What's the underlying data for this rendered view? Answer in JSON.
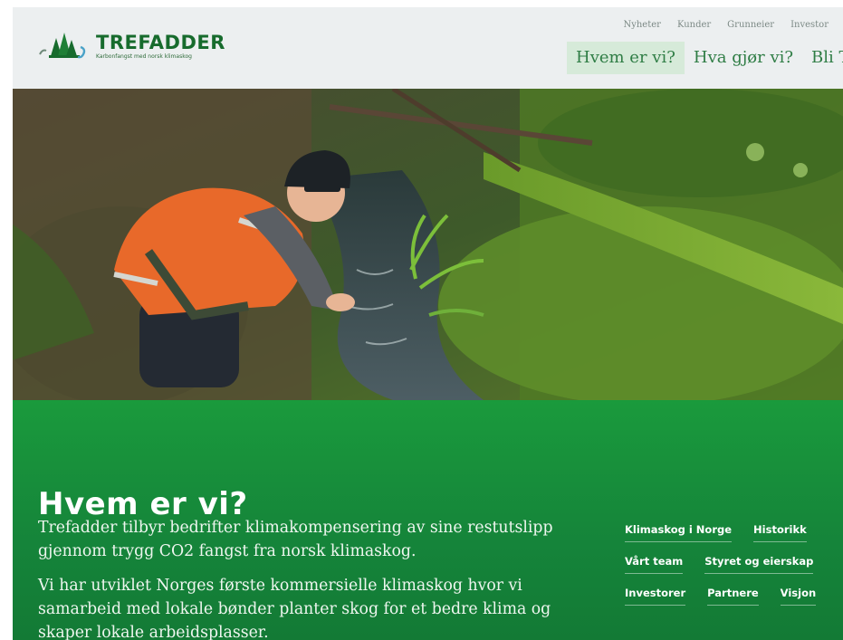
{
  "header": {
    "brand_name": "TREFADDER",
    "brand_tagline": "Karbonfangst med norsk klimaskog",
    "top_links": [
      "Nyheter",
      "Kunder",
      "Grunneier",
      "Investor"
    ],
    "main_nav": [
      "Hvem er vi?",
      "Hva gjør vi?",
      "Bli Trefadder"
    ]
  },
  "hero": {
    "image": "forest-stream-photo"
  },
  "section": {
    "title": "Hvem er vi?",
    "paragraphs": [
      "Trefadder tilbyr bedrifter klimakompensering av sine restutslipp gjennom trygg CO2 fangst fra norsk klimaskog.",
      "Vi har utviklet Norges første kommersielle klimaskog hvor vi samarbeid med lokale bønder planter skog for et bedre klima og skaper lokale arbeidsplasser."
    ],
    "sublinks": [
      [
        "Klimaskog i Norge",
        "Historikk"
      ],
      [
        "Vårt team",
        "Styret og eierskap"
      ],
      [
        "Investorer",
        "Partnere",
        "Visjon"
      ]
    ]
  },
  "colors": {
    "brand_green": "#176b2d",
    "section_green": "#1a9a3c",
    "header_bg": "#eceff0",
    "nav_active_bg": "#d6ead9"
  }
}
